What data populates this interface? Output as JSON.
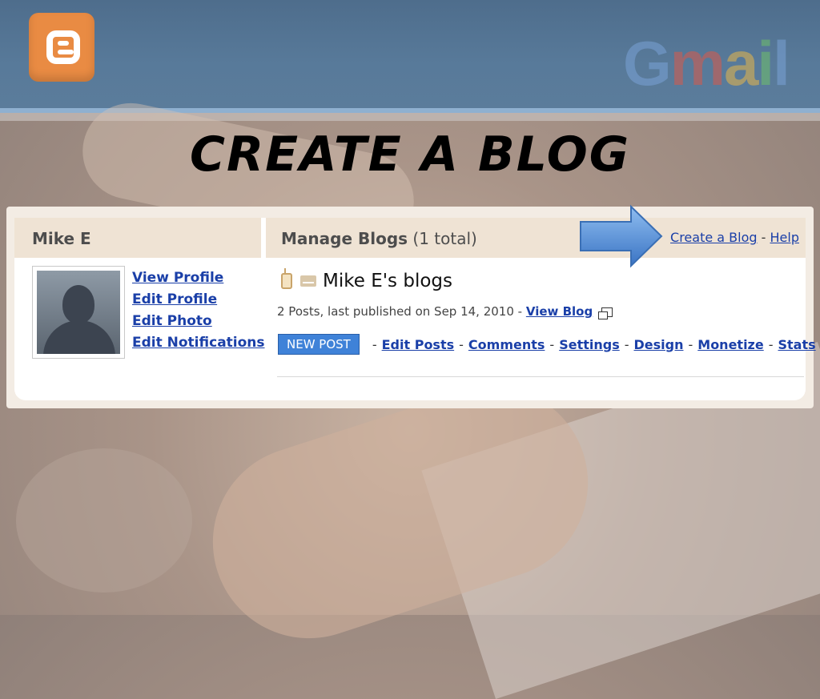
{
  "slide": {
    "title": "CREATE A BLOG"
  },
  "banner": {
    "gmail_logo": {
      "g": "G",
      "m": "m",
      "a": "a",
      "i": "i",
      "l": "l"
    }
  },
  "colors": {
    "banner": "#587a9a",
    "blogger_orange": "#e98b43",
    "link_blue": "#1a3fa8",
    "header_bg": "#efe3d4",
    "new_post_blue": "#3f82d8",
    "arrow_blue": "#4f8fdc"
  },
  "icons": {
    "blogger_logo": "blogger-logo-icon",
    "gmail_logo": "gmail-logo",
    "mobile": "mobile-phone-icon",
    "email": "envelope-icon",
    "external": "external-window-icon",
    "arrow": "right-arrow-icon"
  },
  "profile": {
    "name": "Mike E",
    "links": {
      "view_profile": "View Profile",
      "edit_profile": "Edit Profile",
      "edit_photo": "Edit Photo",
      "edit_notifications": "Edit Notifications"
    }
  },
  "manage": {
    "heading": "Manage Blogs",
    "count": "(1 total)",
    "create_blog": "Create a Blog",
    "dash": "-",
    "help": "Help"
  },
  "blog": {
    "name": "Mike E's blogs",
    "meta": "2 Posts, last published on Sep 14, 2010 -",
    "view_blog": "View Blog",
    "new_post": "NEW POST",
    "actions": {
      "edit_posts": "Edit Posts",
      "comments": "Comments",
      "settings": "Settings",
      "design": "Design",
      "monetize": "Monetize",
      "stats": "Stats"
    }
  }
}
